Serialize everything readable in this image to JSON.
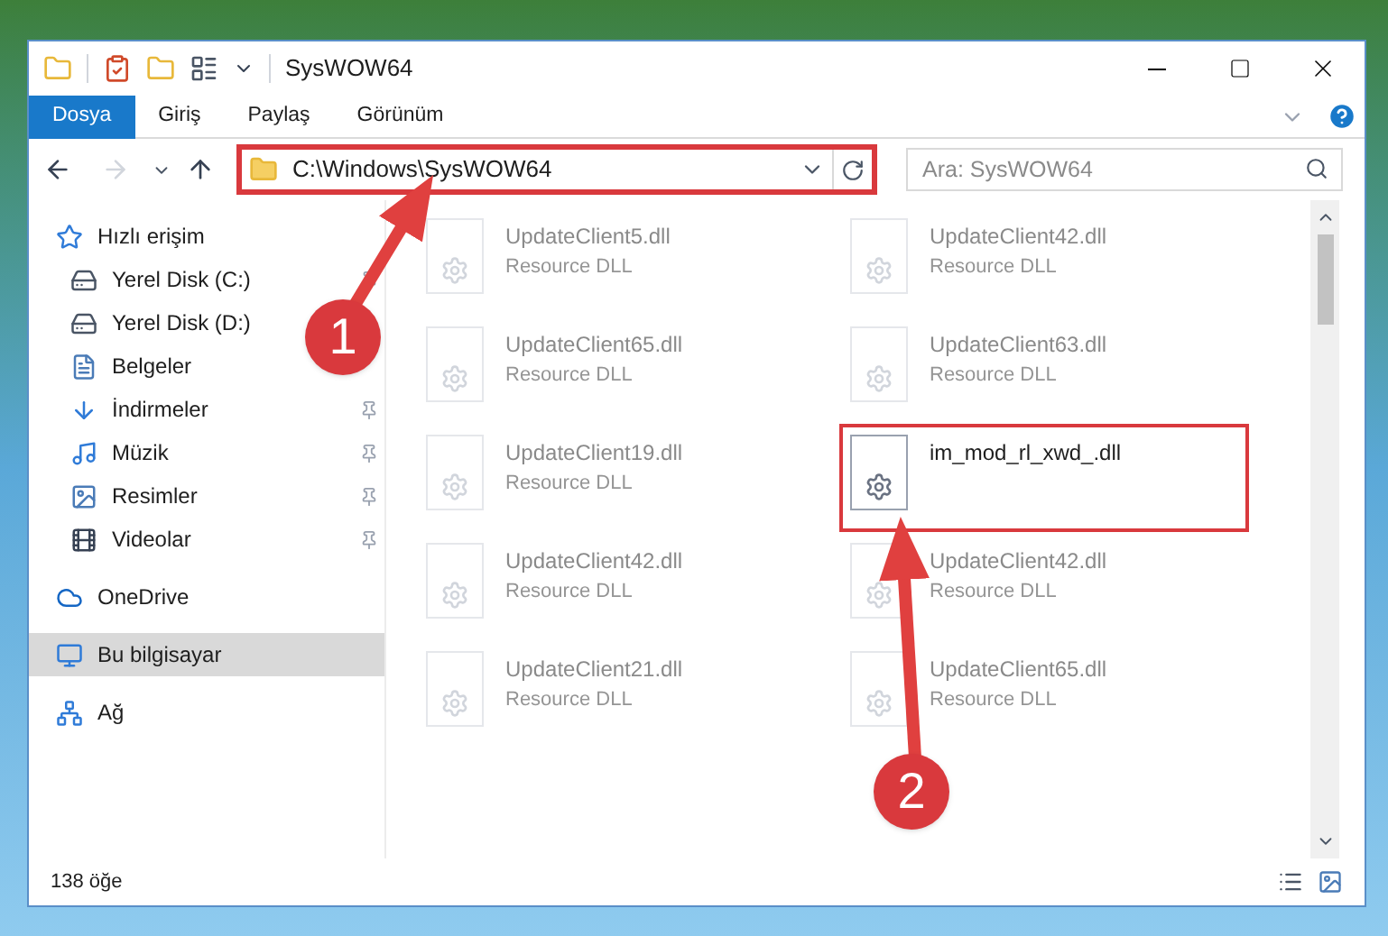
{
  "window": {
    "title": "SysWOW64"
  },
  "ribbon_tabs": [
    {
      "label": "Dosya",
      "selected": true
    },
    {
      "label": "Giriş",
      "selected": false
    },
    {
      "label": "Paylaş",
      "selected": false
    },
    {
      "label": "Görünüm",
      "selected": false
    }
  ],
  "address_bar": {
    "path": "C:\\Windows\\SysWOW64",
    "highlighted": true
  },
  "search": {
    "placeholder": "Ara: SysWOW64"
  },
  "sidebar": {
    "items": [
      {
        "label": "Hızlı erişim",
        "kind": "star",
        "pinned": false,
        "selected": false,
        "children": [
          {
            "label": "Yerel Disk (C:)",
            "kind": "drive",
            "pinned": true,
            "selected": false
          },
          {
            "label": "Yerel Disk (D:)",
            "kind": "drive",
            "pinned": false,
            "selected": false
          },
          {
            "label": "Belgeler",
            "kind": "document",
            "pinned": false,
            "selected": false
          },
          {
            "label": "İndirmeler",
            "kind": "download",
            "pinned": true,
            "selected": false
          },
          {
            "label": "Müzik",
            "kind": "music",
            "pinned": true,
            "selected": false
          },
          {
            "label": "Resimler",
            "kind": "picture",
            "pinned": true,
            "selected": false
          },
          {
            "label": "Videolar",
            "kind": "video",
            "pinned": true,
            "selected": false
          }
        ]
      },
      {
        "label": "OneDrive",
        "kind": "cloud",
        "pinned": false,
        "selected": false
      },
      {
        "label": "Bu bilgisayar",
        "kind": "computer",
        "pinned": false,
        "selected": true
      },
      {
        "label": "Ağ",
        "kind": "network",
        "pinned": false,
        "selected": false
      }
    ]
  },
  "files": [
    {
      "name": "UpdateClient5.dll",
      "type": "Resource DLL",
      "blurred": true,
      "highlighted": false
    },
    {
      "name": "UpdateClient42.dll",
      "type": "Resource DLL",
      "blurred": true,
      "highlighted": false
    },
    {
      "name": "UpdateClient65.dll",
      "type": "Resource DLL",
      "blurred": true,
      "highlighted": false
    },
    {
      "name": "UpdateClient63.dll",
      "type": "Resource DLL",
      "blurred": true,
      "highlighted": false
    },
    {
      "name": "UpdateClient19.dll",
      "type": "Resource DLL",
      "blurred": true,
      "highlighted": false
    },
    {
      "name": "im_mod_rl_xwd_.dll",
      "blurred": false,
      "highlighted": true
    },
    {
      "name": "UpdateClient42.dll",
      "type": "Resource DLL",
      "blurred": true,
      "highlighted": false
    },
    {
      "name": "UpdateClient42.dll",
      "type": "Resource DLL",
      "blurred": true,
      "highlighted": false
    },
    {
      "name": "UpdateClient21.dll",
      "type": "Resource DLL",
      "blurred": true,
      "highlighted": false
    },
    {
      "name": "UpdateClient65.dll",
      "type": "Resource DLL",
      "blurred": true,
      "highlighted": false
    }
  ],
  "status_bar": {
    "item_count": "138 öğe"
  },
  "callouts": [
    {
      "label": "1"
    },
    {
      "label": "2"
    }
  ]
}
